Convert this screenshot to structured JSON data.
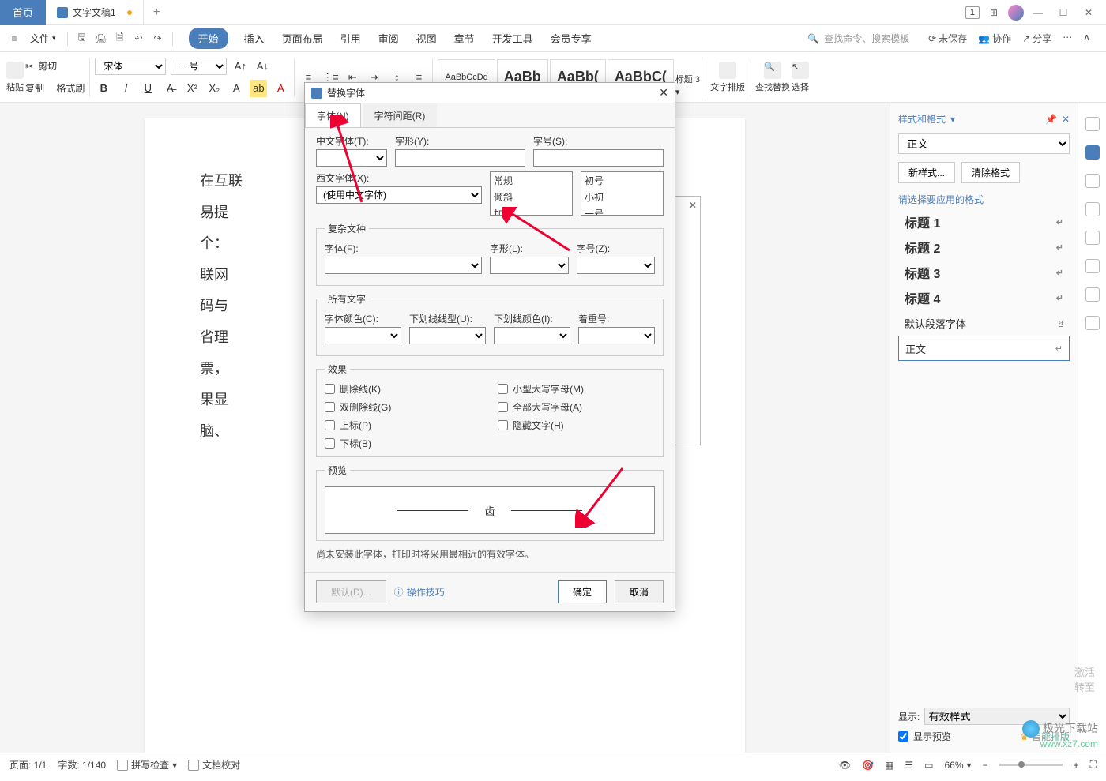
{
  "titlebar": {
    "home": "首页",
    "doc_name": "文字文稿1",
    "badge": "1"
  },
  "menubar": {
    "file": "文件",
    "tabs": [
      "开始",
      "插入",
      "页面布局",
      "引用",
      "审阅",
      "视图",
      "章节",
      "开发工具",
      "会员专享"
    ],
    "search_placeholder": "查找命令、搜索模板",
    "unsaved": "未保存",
    "cooperate": "协作",
    "share": "分享"
  },
  "ribbon": {
    "paste": "粘贴",
    "cut": "剪切",
    "copy": "复制",
    "format_painter": "格式刷",
    "font_name": "宋体",
    "font_size": "一号",
    "style_preview1": "AaBbCcDd",
    "style_preview2": "AaBb",
    "style_preview3": "AaBb(",
    "style_preview4": "AaBbC(",
    "style_label": "标题 3",
    "text_layout": "文字排版",
    "find_replace": "查找替换",
    "select": "选择"
  },
  "document": {
    "lines": [
      "在互联",
      "易提",
      "个：",
      "联网",
      "码与",
      "省理",
      "票，",
      "果显",
      "脑、"
    ]
  },
  "dialog": {
    "title": "替换字体",
    "tab_font": "字体(N)",
    "tab_spacing": "字符间距(R)",
    "lbl_cn_font": "中文字体(T):",
    "lbl_style": "字形(Y):",
    "lbl_size": "字号(S):",
    "style_options": [
      "常规",
      "倾斜",
      "加粗"
    ],
    "size_options": [
      "初号",
      "小初",
      "一号"
    ],
    "lbl_western": "西文字体(X):",
    "western_value": "(使用中文字体)",
    "fs_complex": "复杂文种",
    "lbl_font2": "字体(F):",
    "lbl_style2": "字形(L):",
    "lbl_size2": "字号(Z):",
    "fs_all": "所有文字",
    "lbl_color": "字体颜色(C):",
    "lbl_underline": "下划线线型(U):",
    "lbl_ucolor": "下划线颜色(I):",
    "lbl_emphasis": "着重号:",
    "fs_effect": "效果",
    "chk_strike": "删除线(K)",
    "chk_dstrike": "双删除线(G)",
    "chk_super": "上标(P)",
    "chk_sub": "下标(B)",
    "chk_smallcaps": "小型大写字母(M)",
    "chk_allcaps": "全部大写字母(A)",
    "chk_hidden": "隐藏文字(H)",
    "fs_preview": "预览",
    "preview_char": "齿",
    "note": "尚未安装此字体，打印时将采用最相近的有效字体。",
    "btn_default": "默认(D)...",
    "link_tips": "操作技巧",
    "btn_ok": "确定",
    "btn_cancel": "取消"
  },
  "sidebar": {
    "title": "样式和格式",
    "current": "正文",
    "btn_new": "新样式...",
    "btn_clear": "清除格式",
    "prompt": "请选择要应用的格式",
    "styles": [
      "标题 1",
      "标题 2",
      "标题 3",
      "标题 4"
    ],
    "default_para": "默认段落字体",
    "body": "正文",
    "show_label": "显示:",
    "show_value": "有效样式",
    "preview_check": "显示预览",
    "smart_layout": "智能排版"
  },
  "statusbar": {
    "page": "页面: 1/1",
    "words": "字数: 1/140",
    "spellcheck": "拼写检查",
    "docproof": "文档校对",
    "zoom": "66%"
  },
  "watermark": {
    "brand": "极光下载站",
    "url": "www.xz7.com",
    "activate": "激活",
    "activate2": "转至"
  }
}
